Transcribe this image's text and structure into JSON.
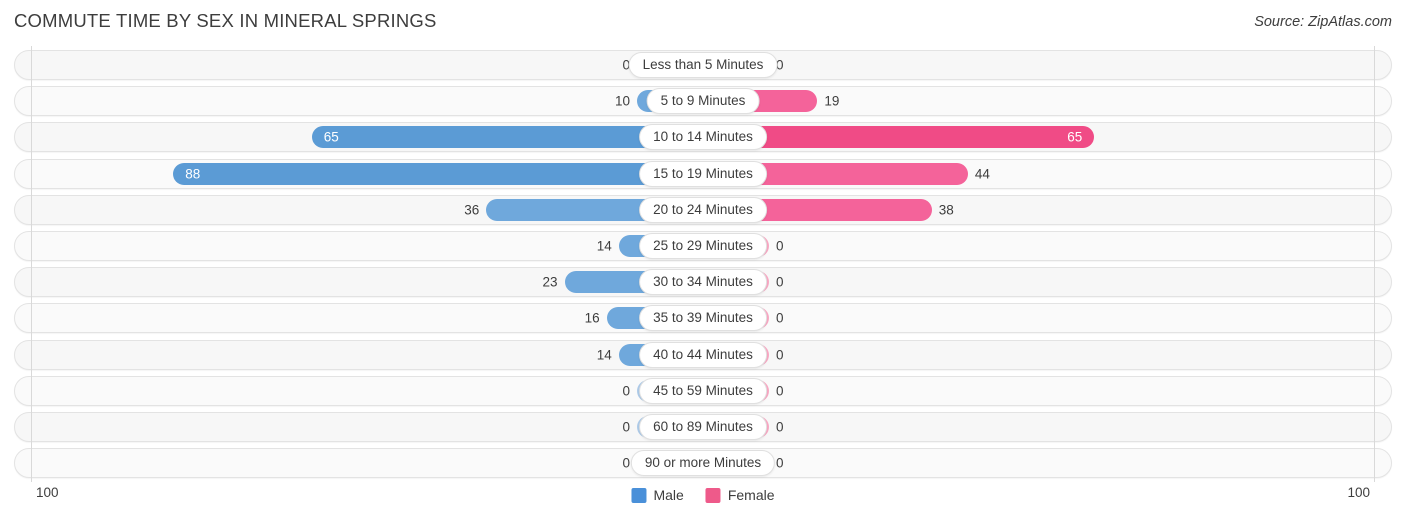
{
  "header": {
    "title": "COMMUTE TIME BY SEX IN MINERAL SPRINGS",
    "source": "Source: ZipAtlas.com"
  },
  "legend": {
    "male_label": "Male",
    "female_label": "Female",
    "male_color": "#4a90d9",
    "female_color": "#ee5a8a"
  },
  "axis": {
    "left_end": "100",
    "right_end": "100",
    "max": 100
  },
  "colors": {
    "male_strong": "#6fa8dc",
    "male_light": "#aecbe9",
    "female_strong": "#f4639a",
    "female_light": "#f9a8c4",
    "female_highlight": "#f04b86",
    "male_highlight": "#5b9bd5"
  },
  "chart_data": {
    "type": "bar",
    "orientation": "horizontal-diverging",
    "title": "COMMUTE TIME BY SEX IN MINERAL SPRINGS",
    "xlabel": "",
    "ylabel": "",
    "xlim": [
      100,
      100
    ],
    "grid": true,
    "legend_position": "bottom-center",
    "categories": [
      "Less than 5 Minutes",
      "5 to 9 Minutes",
      "10 to 14 Minutes",
      "15 to 19 Minutes",
      "20 to 24 Minutes",
      "25 to 29 Minutes",
      "30 to 34 Minutes",
      "35 to 39 Minutes",
      "40 to 44 Minutes",
      "45 to 59 Minutes",
      "60 to 89 Minutes",
      "90 or more Minutes"
    ],
    "series": [
      {
        "name": "Male",
        "values": [
          0,
          10,
          65,
          88,
          36,
          14,
          23,
          16,
          14,
          0,
          0,
          0
        ]
      },
      {
        "name": "Female",
        "values": [
          0,
          19,
          65,
          44,
          38,
          0,
          0,
          0,
          0,
          0,
          0,
          0
        ]
      }
    ]
  },
  "rows": [
    {
      "category": "Less than 5 Minutes",
      "male": "0",
      "female": "0",
      "male_value": 0,
      "female_value": 0,
      "male_min": true,
      "female_min": true,
      "male_inline": false,
      "female_inline": false,
      "male_hl": false,
      "female_hl": false
    },
    {
      "category": "5 to 9 Minutes",
      "male": "10",
      "female": "19",
      "male_value": 10,
      "female_value": 19,
      "male_min": false,
      "female_min": false,
      "male_inline": false,
      "female_inline": false,
      "male_hl": false,
      "female_hl": false
    },
    {
      "category": "10 to 14 Minutes",
      "male": "65",
      "female": "65",
      "male_value": 65,
      "female_value": 65,
      "male_min": false,
      "female_min": false,
      "male_inline": true,
      "female_inline": true,
      "male_hl": true,
      "female_hl": true
    },
    {
      "category": "15 to 19 Minutes",
      "male": "88",
      "female": "44",
      "male_value": 88,
      "female_value": 44,
      "male_min": false,
      "female_min": false,
      "male_inline": true,
      "female_inline": false,
      "male_hl": true,
      "female_hl": false
    },
    {
      "category": "20 to 24 Minutes",
      "male": "36",
      "female": "38",
      "male_value": 36,
      "female_value": 38,
      "male_min": false,
      "female_min": false,
      "male_inline": false,
      "female_inline": false,
      "male_hl": false,
      "female_hl": false
    },
    {
      "category": "25 to 29 Minutes",
      "male": "14",
      "female": "0",
      "male_value": 14,
      "female_value": 0,
      "male_min": false,
      "female_min": true,
      "male_inline": false,
      "female_inline": false,
      "male_hl": false,
      "female_hl": false
    },
    {
      "category": "30 to 34 Minutes",
      "male": "23",
      "female": "0",
      "male_value": 23,
      "female_value": 0,
      "male_min": false,
      "female_min": true,
      "male_inline": false,
      "female_inline": false,
      "male_hl": false,
      "female_hl": false
    },
    {
      "category": "35 to 39 Minutes",
      "male": "16",
      "female": "0",
      "male_value": 16,
      "female_value": 0,
      "male_min": false,
      "female_min": true,
      "male_inline": false,
      "female_inline": false,
      "male_hl": false,
      "female_hl": false
    },
    {
      "category": "40 to 44 Minutes",
      "male": "14",
      "female": "0",
      "male_value": 14,
      "female_value": 0,
      "male_min": false,
      "female_min": true,
      "male_inline": false,
      "female_inline": false,
      "male_hl": false,
      "female_hl": false
    },
    {
      "category": "45 to 59 Minutes",
      "male": "0",
      "female": "0",
      "male_value": 0,
      "female_value": 0,
      "male_min": true,
      "female_min": true,
      "male_inline": false,
      "female_inline": false,
      "male_hl": false,
      "female_hl": false
    },
    {
      "category": "60 to 89 Minutes",
      "male": "0",
      "female": "0",
      "male_value": 0,
      "female_value": 0,
      "male_min": true,
      "female_min": true,
      "male_inline": false,
      "female_inline": false,
      "male_hl": false,
      "female_hl": false
    },
    {
      "category": "90 or more Minutes",
      "male": "0",
      "female": "0",
      "male_value": 0,
      "female_value": 0,
      "male_min": true,
      "female_min": true,
      "male_inline": false,
      "female_inline": false,
      "male_hl": false,
      "female_hl": false
    }
  ]
}
